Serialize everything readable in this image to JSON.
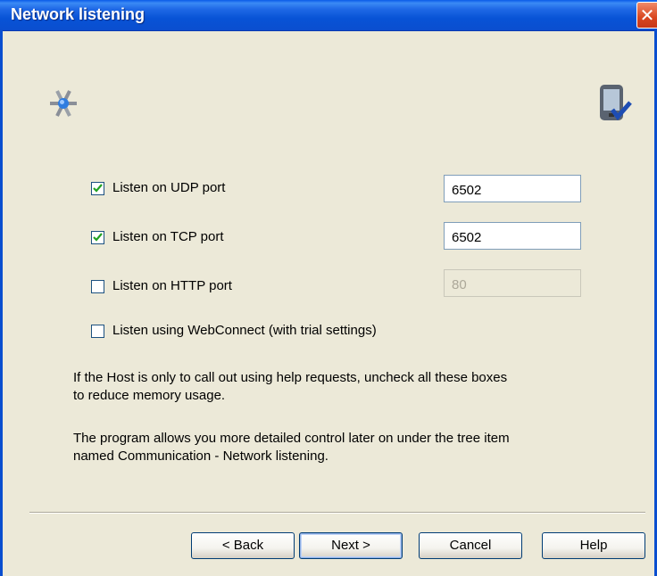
{
  "window": {
    "title": "Network listening",
    "close_symbol": "✕"
  },
  "options": [
    {
      "label": "Listen on UDP port",
      "checked": true,
      "port": "6502",
      "port_enabled": true
    },
    {
      "label": "Listen on TCP port",
      "checked": true,
      "port": "6502",
      "port_enabled": true
    },
    {
      "label": "Listen on HTTP port",
      "checked": false,
      "port": "80",
      "port_enabled": false
    },
    {
      "label": "Listen using WebConnect (with trial settings)",
      "checked": false
    }
  ],
  "info": {
    "line1": "If the Host is only to call out using help requests, uncheck all these boxes",
    "line2": "to reduce memory usage.",
    "line3": "The program allows you more detailed control later on under the tree item",
    "line4": "named Communication - Network listening."
  },
  "buttons": {
    "back": "< Back",
    "next": "Next >",
    "cancel": "Cancel",
    "help": "Help"
  },
  "colors": {
    "title_bar": "#0a4ecf",
    "checkmark": "#21a121",
    "close": "#d9461f"
  }
}
